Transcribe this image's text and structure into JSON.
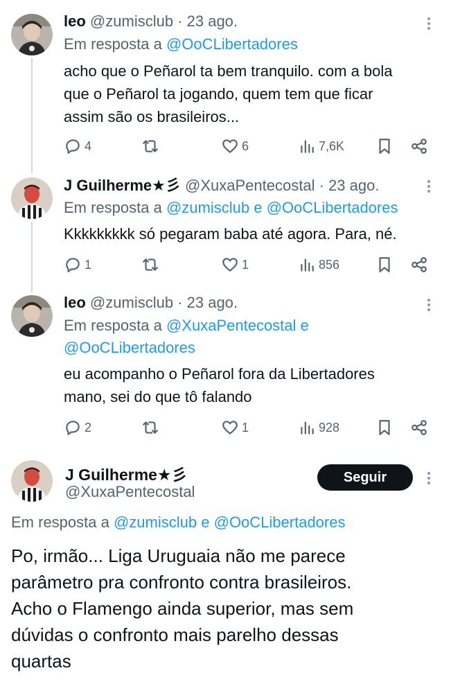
{
  "tweets": [
    {
      "name": "leo",
      "handle": "@zumisclub",
      "time": "· 23 ago.",
      "reply_prefix": "Em resposta a",
      "reply_to": [
        "@OoCLibertadores"
      ],
      "text": [
        "acho que o Peñarol ta bem tranquilo. com a bola",
        "que o Peñarol ta jogando, quem tem que ficar",
        "assim são os brasileiros..."
      ],
      "replies": "4",
      "retweets": "",
      "likes": "6",
      "views": "7,6K"
    },
    {
      "name": "J Guilherme★彡",
      "handle": "@XuxaPentecostal",
      "time": "· 23 ago.",
      "reply_prefix": "Em resposta a",
      "reply_to": [
        "@zumisclub",
        "@OoCLibertadores"
      ],
      "conj": "e",
      "text": [
        "Kkkkkkkkk só pegaram baba até agora. Para, né."
      ],
      "replies": "1",
      "retweets": "",
      "likes": "1",
      "views": "856"
    },
    {
      "name": "leo",
      "handle": "@zumisclub",
      "time": "· 23 ago.",
      "reply_prefix": "Em resposta a",
      "reply_to": [
        "@XuxaPentecostal",
        "@OoCLibertadores"
      ],
      "conj": "e",
      "text": [
        "eu acompanho o Peñarol fora da Libertadores",
        "mano, sei do que tô falando"
      ],
      "replies": "2",
      "retweets": "",
      "likes": "1",
      "views": "928"
    }
  ],
  "focus": {
    "name": "J Guilherme★彡",
    "handle": "@XuxaPentecostal",
    "follow_label": "Seguir",
    "reply_prefix": "Em resposta a",
    "reply_to": [
      "@zumisclub",
      "@OoCLibertadores"
    ],
    "conj": "e",
    "text": [
      "Po, irmão... Liga Uruguaia não me parece",
      "parâmetro pra confronto contra brasileiros.",
      "Acho o Flamengo ainda superior, mas sem",
      "dúvidas o confronto mais parelho dessas",
      "quartas"
    ]
  },
  "icons": [
    "more-icon",
    "reply-icon",
    "retweet-icon",
    "like-icon",
    "views-icon",
    "bookmark-icon",
    "share-icon"
  ],
  "colors": {
    "link": "#1d9bf0",
    "muted": "#536471",
    "text": "#0f1419",
    "button": "#0f1419"
  }
}
